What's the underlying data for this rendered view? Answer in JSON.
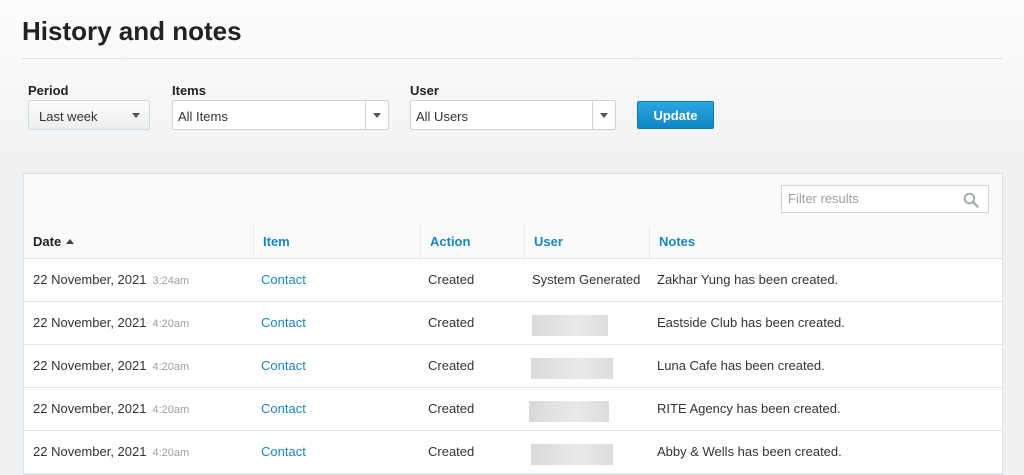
{
  "page": {
    "title": "History and notes"
  },
  "filters": {
    "period": {
      "label": "Period",
      "value": "Last week"
    },
    "items": {
      "label": "Items",
      "value": "All Items"
    },
    "user": {
      "label": "User",
      "value": "All Users"
    },
    "update_label": "Update"
  },
  "table": {
    "filter_placeholder": "Filter results",
    "columns": {
      "date": "Date",
      "item": "Item",
      "action": "Action",
      "user": "User",
      "notes": "Notes"
    },
    "sort": {
      "column": "date",
      "direction": "ascending"
    },
    "rows": [
      {
        "date": "22 November, 2021",
        "time": "3:24am",
        "item": "Contact",
        "action": "Created",
        "user": "System Generated",
        "notes": "Zakhar Yung has been created."
      },
      {
        "date": "22 November, 2021",
        "time": "4:20am",
        "item": "Contact",
        "action": "Created",
        "user": "",
        "notes": "Eastside Club has been created."
      },
      {
        "date": "22 November, 2021",
        "time": "4:20am",
        "item": "Contact",
        "action": "Created",
        "user": "",
        "notes": "Luna Cafe has been created."
      },
      {
        "date": "22 November, 2021",
        "time": "4:20am",
        "item": "Contact",
        "action": "Created",
        "user": "",
        "notes": "RITE Agency has been created."
      },
      {
        "date": "22 November, 2021",
        "time": "4:20am",
        "item": "Contact",
        "action": "Created",
        "user": "",
        "notes": "Abby & Wells has been created."
      }
    ]
  },
  "icons": {
    "search": "search-icon",
    "dropdown": "chevron-down-icon",
    "sort": "sort-ascending-icon"
  },
  "colors": {
    "accent": "#1a86c1",
    "button": "#1a95d3"
  }
}
